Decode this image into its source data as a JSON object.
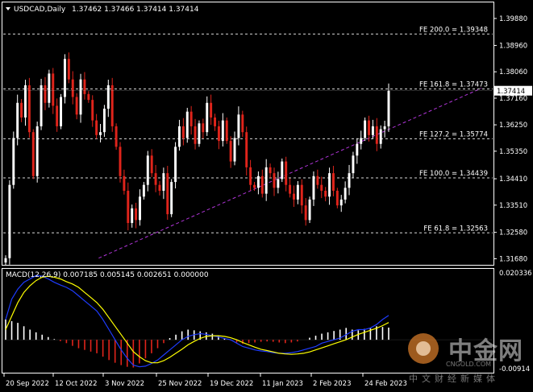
{
  "chart_data": {
    "type": "candlestick",
    "title": "USDCAD,Daily",
    "header_values": "1.37462 1.37466 1.37414 1.37414",
    "price_axis": {
      "ylim": [
        1.315,
        1.404
      ],
      "ticks": [
        "1.39880",
        "1.38960",
        "1.38060",
        "1.37160",
        "1.36250",
        "1.35350",
        "1.34410",
        "1.33510",
        "1.32580",
        "1.31680"
      ],
      "current_price": "1.37414"
    },
    "x_ticks": [
      "20 Sep 2022",
      "12 Oct 2022",
      "3 Nov 2022",
      "25 Nov 2022",
      "19 Dec 2022",
      "11 Jan 2023",
      "2 Feb 2023",
      "24 Feb 2023"
    ],
    "fib_levels": [
      {
        "label": "FE 200.0 = 1.39348",
        "value": 1.39348
      },
      {
        "label": "FE 161.8 = 1.37473",
        "value": 1.37473
      },
      {
        "label": "FE 127.2 = 1.35774",
        "value": 1.35774
      },
      {
        "label": "FE 100.0 = 1.34439",
        "value": 1.34439
      },
      {
        "label": "FE 61.8 = 1.32563",
        "value": 1.32563
      }
    ],
    "trendline": {
      "from": [
        0.195,
        1.317
      ],
      "to": [
        0.977,
        1.375
      ]
    },
    "closes": [
      1.317,
      1.342,
      1.358,
      1.37,
      1.365,
      1.376,
      1.36,
      1.345,
      1.362,
      1.376,
      1.37,
      1.38,
      1.369,
      1.362,
      1.372,
      1.385,
      1.378,
      1.372,
      1.366,
      1.378,
      1.373,
      1.371,
      1.364,
      1.359,
      1.36,
      1.368,
      1.376,
      1.362,
      1.355,
      1.345,
      1.34,
      1.329,
      1.334,
      1.33,
      1.338,
      1.342,
      1.352,
      1.346,
      1.342,
      1.34,
      1.346,
      1.332,
      1.343,
      1.355,
      1.362,
      1.358,
      1.367,
      1.362,
      1.356,
      1.363,
      1.36,
      1.37,
      1.365,
      1.362,
      1.357,
      1.364,
      1.357,
      1.35,
      1.358,
      1.366,
      1.36,
      1.348,
      1.342,
      1.341,
      1.345,
      1.339,
      1.348,
      1.346,
      1.341,
      1.344,
      1.35,
      1.342,
      1.339,
      1.337,
      1.342,
      1.335,
      1.33,
      1.337,
      1.345,
      1.342,
      1.34,
      1.338,
      1.346,
      1.34,
      1.335,
      1.337,
      1.341,
      1.346,
      1.352,
      1.356,
      1.358,
      1.364,
      1.359,
      1.362,
      1.356,
      1.361,
      1.362,
      1.3741
    ],
    "macd": {
      "label": "MACD(12,26,9) 0.007185 0.005145 0.002651 0.000000",
      "ylim": [
        -0.0095,
        0.0205
      ],
      "ticks": [
        "0.020336",
        "-0.00914"
      ],
      "macd_line": [
        0.006,
        0.012,
        0.015,
        0.017,
        0.018,
        0.019,
        0.0188,
        0.018,
        0.017,
        0.0162,
        0.0155,
        0.0145,
        0.013,
        0.0115,
        0.01,
        0.0085,
        0.006,
        0.003,
        0.0,
        -0.003,
        -0.0055,
        -0.0075,
        -0.008,
        -0.0078,
        -0.007,
        -0.006,
        -0.0045,
        -0.003,
        -0.0015,
        0.0,
        0.001,
        0.0015,
        0.0018,
        0.0016,
        0.0012,
        0.0008,
        0.0004,
        0.0,
        -0.001,
        -0.002,
        -0.0025,
        -0.003,
        -0.0033,
        -0.0035,
        -0.0038,
        -0.004,
        -0.004,
        -0.0038,
        -0.0035,
        -0.003,
        -0.0025,
        -0.002,
        -0.001,
        -0.0005,
        0.0,
        0.0005,
        0.0015,
        0.0025,
        0.003,
        0.003,
        0.0035,
        0.0045,
        0.006,
        0.0072
      ],
      "signal_line": [
        0.003,
        0.007,
        0.011,
        0.014,
        0.016,
        0.0175,
        0.0185,
        0.0188,
        0.0185,
        0.018,
        0.0172,
        0.0165,
        0.0155,
        0.014,
        0.0125,
        0.011,
        0.009,
        0.0065,
        0.004,
        0.0015,
        -0.001,
        -0.0035,
        -0.005,
        -0.0062,
        -0.0068,
        -0.0068,
        -0.0062,
        -0.0052,
        -0.004,
        -0.0028,
        -0.0015,
        -0.0005,
        0.0004,
        0.001,
        0.0012,
        0.0012,
        0.001,
        0.0006,
        0.0,
        -0.0008,
        -0.0015,
        -0.0022,
        -0.0028,
        -0.0032,
        -0.0036,
        -0.004,
        -0.0042,
        -0.0043,
        -0.0042,
        -0.004,
        -0.0036,
        -0.003,
        -0.0024,
        -0.0018,
        -0.0012,
        -0.0006,
        0.0,
        0.0008,
        0.0016,
        0.0022,
        0.0028,
        0.0034,
        0.0042,
        0.0051
      ],
      "histogram": [
        0.006,
        0.0055,
        0.005,
        0.004,
        0.003,
        0.0022,
        0.0015,
        0.0008,
        0.0002,
        -0.0004,
        -0.001,
        -0.0018,
        -0.0025,
        -0.003,
        -0.0035,
        -0.004,
        -0.005,
        -0.006,
        -0.0068,
        -0.0075,
        -0.008,
        -0.0082,
        -0.007,
        -0.0055,
        -0.004,
        -0.0025,
        -0.001,
        0.0005,
        0.0015,
        0.0025,
        0.003,
        0.0028,
        0.0025,
        0.0022,
        0.0018,
        0.0012,
        0.0005,
        -0.0002,
        -0.0008,
        -0.0012,
        -0.001,
        -0.0008,
        -0.0006,
        -0.0005,
        -0.0006,
        -0.0008,
        -0.001,
        -0.0008,
        -0.0005,
        0.0,
        0.0006,
        0.0012,
        0.0018,
        0.0022,
        0.0026,
        0.003,
        0.0035,
        0.003,
        0.0028,
        0.0032,
        0.0036,
        0.004,
        0.0038,
        0.0036
      ]
    },
    "colors": {
      "bull": "#ffffff",
      "bear": "#e0241b",
      "macd_line": "#1e3cff",
      "signal_line": "#ffff00",
      "grid": "#ffffff",
      "fib_line": "#ffffff",
      "trendline": "#b035d8"
    }
  },
  "watermark": {
    "brand": "中金网",
    "domain": "CNGOLD.COM",
    "slogan": "中文财经新媒体"
  }
}
